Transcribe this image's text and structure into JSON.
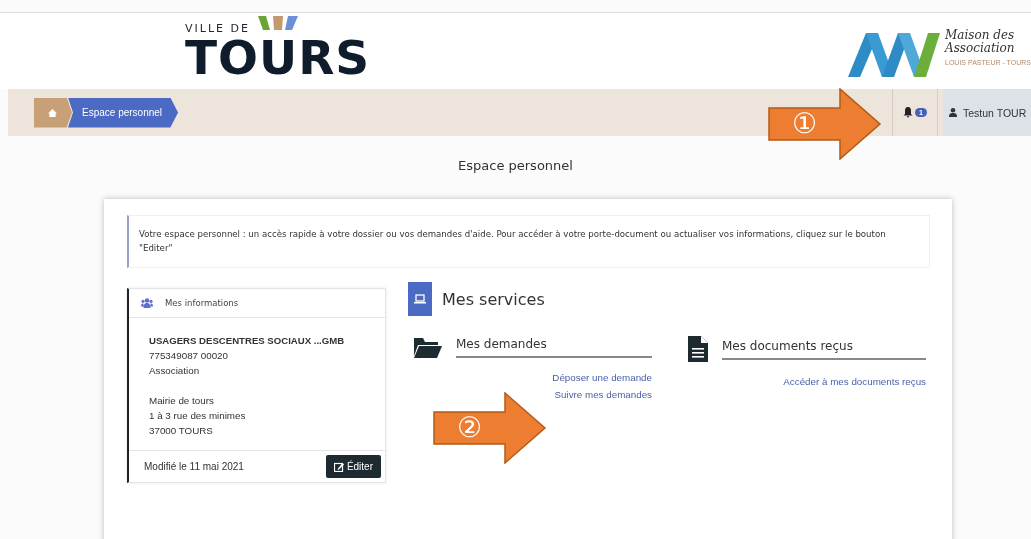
{
  "header": {
    "city_logo": {
      "prefix": "VILLE DE",
      "name": "TOURS"
    },
    "partner_logo": {
      "line1": "Maison des",
      "line2": "Association",
      "tagline": "LOUIS PASTEUR - TOURS"
    }
  },
  "breadcrumb": [
    {
      "kind": "home"
    },
    {
      "kind": "page",
      "label": "Espace personnel"
    }
  ],
  "notifications": {
    "count": "1"
  },
  "user": {
    "name": "Testun TOUR"
  },
  "page_title": "Espace personnel",
  "notice": "Votre espace personnel : un accès rapide à votre dossier ou vos demandes d'aide. Pour accéder à votre porte-document ou actualiser vos informations, cliquez sur le bouton \"Editer\"",
  "info_card": {
    "title": "Mes informations",
    "name": "USAGERS DESCENTRES SOCIAUX ...GMB",
    "lines": [
      "775349087 00020",
      "Association"
    ],
    "address": [
      "Mairie de tours",
      "1 à 3 rue des minimes",
      "37000 TOURS"
    ],
    "modified": "Modifié le 11 mai 2021",
    "edit_button": "Éditer"
  },
  "services": {
    "title": "Mes services",
    "sections": [
      {
        "kind": "folder",
        "title": "Mes demandes",
        "links": [
          "Déposer une demande",
          "Suivre mes demandes"
        ]
      },
      {
        "kind": "document",
        "title": "Mes documents reçus",
        "links": [
          "Accéder à mes documents reçus"
        ]
      }
    ]
  },
  "callouts": [
    {
      "number": "①"
    },
    {
      "number": "②"
    }
  ]
}
